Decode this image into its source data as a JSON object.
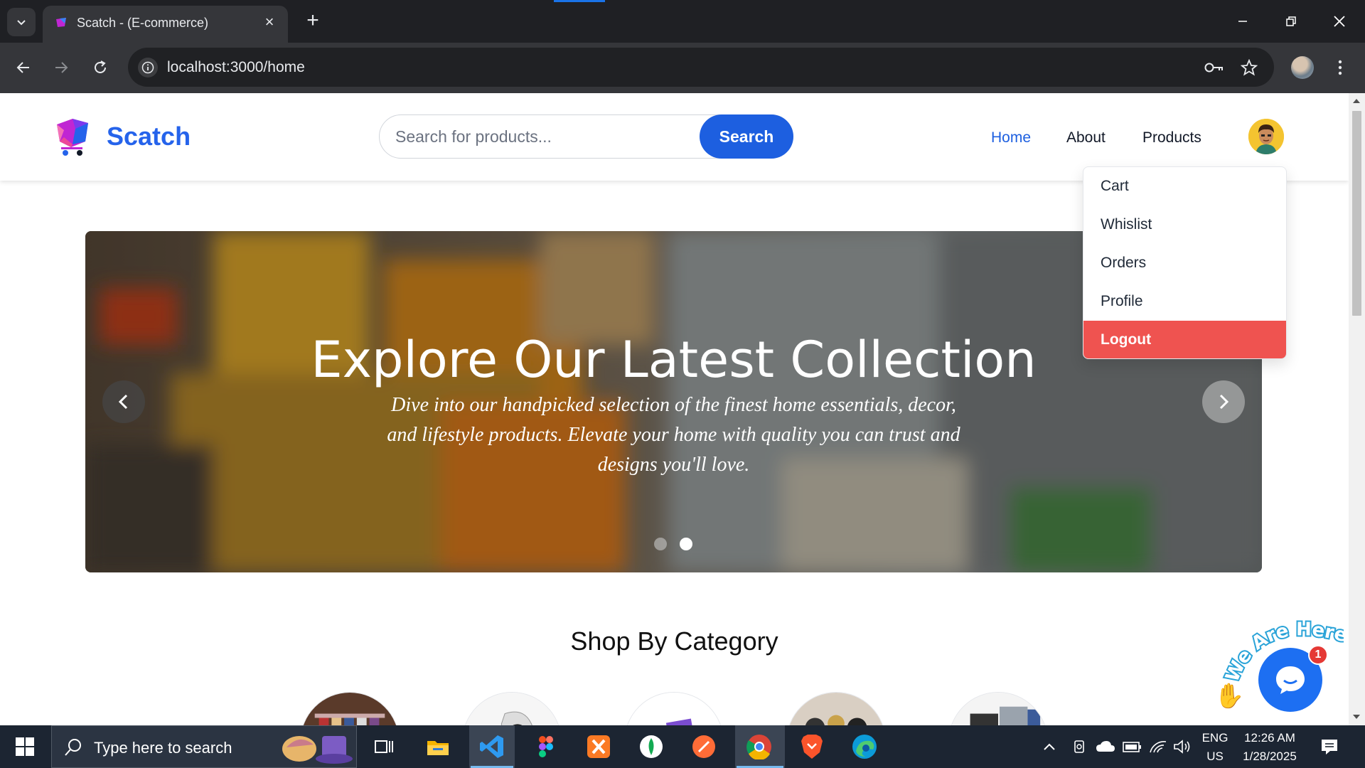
{
  "browser": {
    "tab_title": "Scatch - (E-commerce)",
    "url": "localhost:3000/home"
  },
  "site": {
    "brand": "Scatch",
    "search": {
      "placeholder": "Search for products...",
      "button": "Search"
    },
    "nav": {
      "home": "Home",
      "about": "About",
      "products": "Products"
    },
    "user_menu": {
      "cart": "Cart",
      "wishlist": "Whislist",
      "orders": "Orders",
      "profile": "Profile",
      "logout": "Logout"
    },
    "hero": {
      "title": "Explore Our Latest Collection",
      "subtitle": "Dive into our handpicked selection of the finest home essentials, decor, and lifestyle products. Elevate your home with quality you can trust and designs you'll love.",
      "active_slide": 2,
      "slide_count": 2
    },
    "categories_title": "Shop By Category",
    "chat": {
      "tagline": "We Are Here!",
      "unread": "1"
    }
  },
  "taskbar": {
    "search_placeholder": "Type here to search",
    "lang": "ENG",
    "region": "US",
    "time": "12:26 AM",
    "date": "1/28/2025"
  },
  "colors": {
    "accent": "#1d5fe0",
    "logout": "#ef5350",
    "chat": "#1d6ff2"
  }
}
